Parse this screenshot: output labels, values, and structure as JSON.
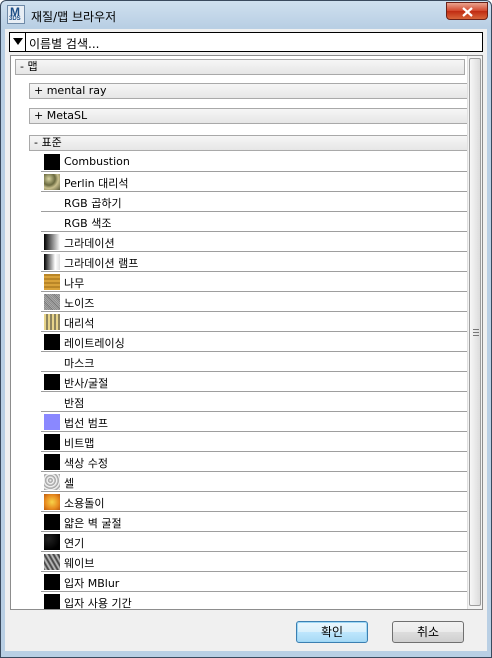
{
  "window": {
    "title": "재질/맵 브라우저",
    "app_icon_text": "M",
    "app_icon_subtext": "3DS"
  },
  "search": {
    "value": "이름별 검색..."
  },
  "categories": [
    {
      "label": "- 맵"
    },
    {
      "label": "+ mental ray"
    },
    {
      "label": "+ MetaSL"
    },
    {
      "label": "- 표준"
    }
  ],
  "items": [
    {
      "label": "Combustion",
      "icon": "black-swatch"
    },
    {
      "label": "Perlin 대리석",
      "icon": "perlin-marble-swatch"
    },
    {
      "label": "RGB 곱하기",
      "icon": "white-swatch"
    },
    {
      "label": "RGB 색조",
      "icon": "white-swatch"
    },
    {
      "label": "그라데이션",
      "icon": "gradient-swatch"
    },
    {
      "label": "그라데이션 램프",
      "icon": "gradient-ramp-swatch"
    },
    {
      "label": "나무",
      "icon": "wood-swatch"
    },
    {
      "label": "노이즈",
      "icon": "noise-swatch"
    },
    {
      "label": "대리석",
      "icon": "marble-swatch"
    },
    {
      "label": "레이트레이싱",
      "icon": "black-swatch"
    },
    {
      "label": "마스크",
      "icon": "white-swatch"
    },
    {
      "label": "반사/굴절",
      "icon": "black-swatch"
    },
    {
      "label": "반점",
      "icon": "white-swatch"
    },
    {
      "label": "법선 범프",
      "icon": "normal-bump-swatch"
    },
    {
      "label": "비트맵",
      "icon": "black-swatch"
    },
    {
      "label": "색상 수정",
      "icon": "black-swatch"
    },
    {
      "label": "셀",
      "icon": "cellular-swatch"
    },
    {
      "label": "소용돌이",
      "icon": "swirl-swatch"
    },
    {
      "label": "얇은 벽 굴절",
      "icon": "black-swatch"
    },
    {
      "label": "연기",
      "icon": "smoke-swatch"
    },
    {
      "label": "웨이브",
      "icon": "wave-swatch"
    },
    {
      "label": "입자 MBlur",
      "icon": "black-swatch"
    },
    {
      "label": "입자 사용 기간",
      "icon": "black-swatch"
    }
  ],
  "buttons": {
    "ok": "확인",
    "cancel": "취소"
  },
  "colors": {
    "title_bar": "#b9cfe4",
    "close_button": "#c9391c",
    "normal_bump": "#8a88ff",
    "focus_border": "#3c7fb1"
  }
}
